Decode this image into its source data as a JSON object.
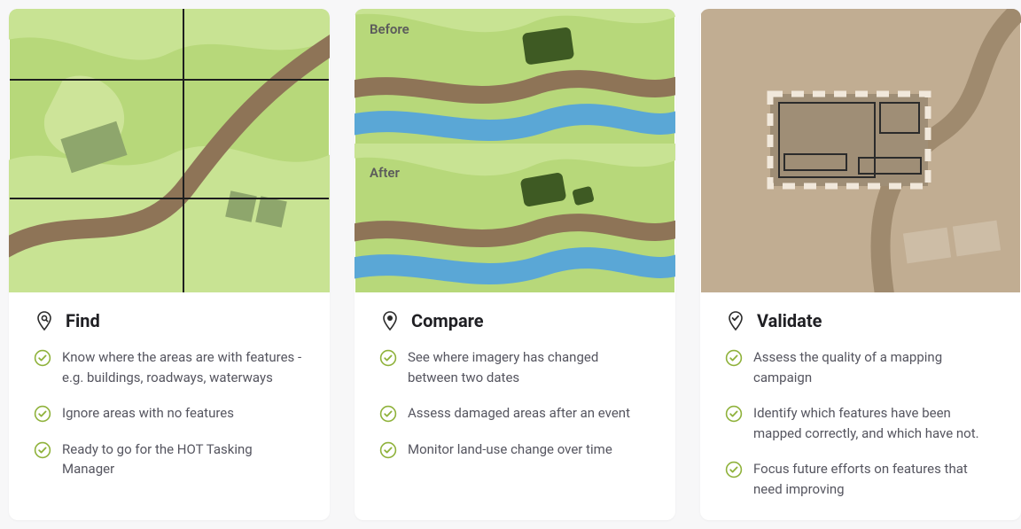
{
  "cards": [
    {
      "title": "Find",
      "bullets": [
        "Know where the areas are with features - e.g. buildings, roadways, waterways",
        "Ignore areas with no features",
        "Ready to go for the HOT Tasking Manager"
      ]
    },
    {
      "title": "Compare",
      "before_label": "Before",
      "after_label": "After",
      "bullets": [
        "See where imagery has changed between two dates",
        "Assess damaged areas after an event",
        "Monitor land-use change over time"
      ]
    },
    {
      "title": "Validate",
      "bullets": [
        "Assess the quality of a mapping campaign",
        "Identify which features have been mapped correctly, and which have not.",
        "Focus future efforts on features that need improving"
      ]
    }
  ]
}
